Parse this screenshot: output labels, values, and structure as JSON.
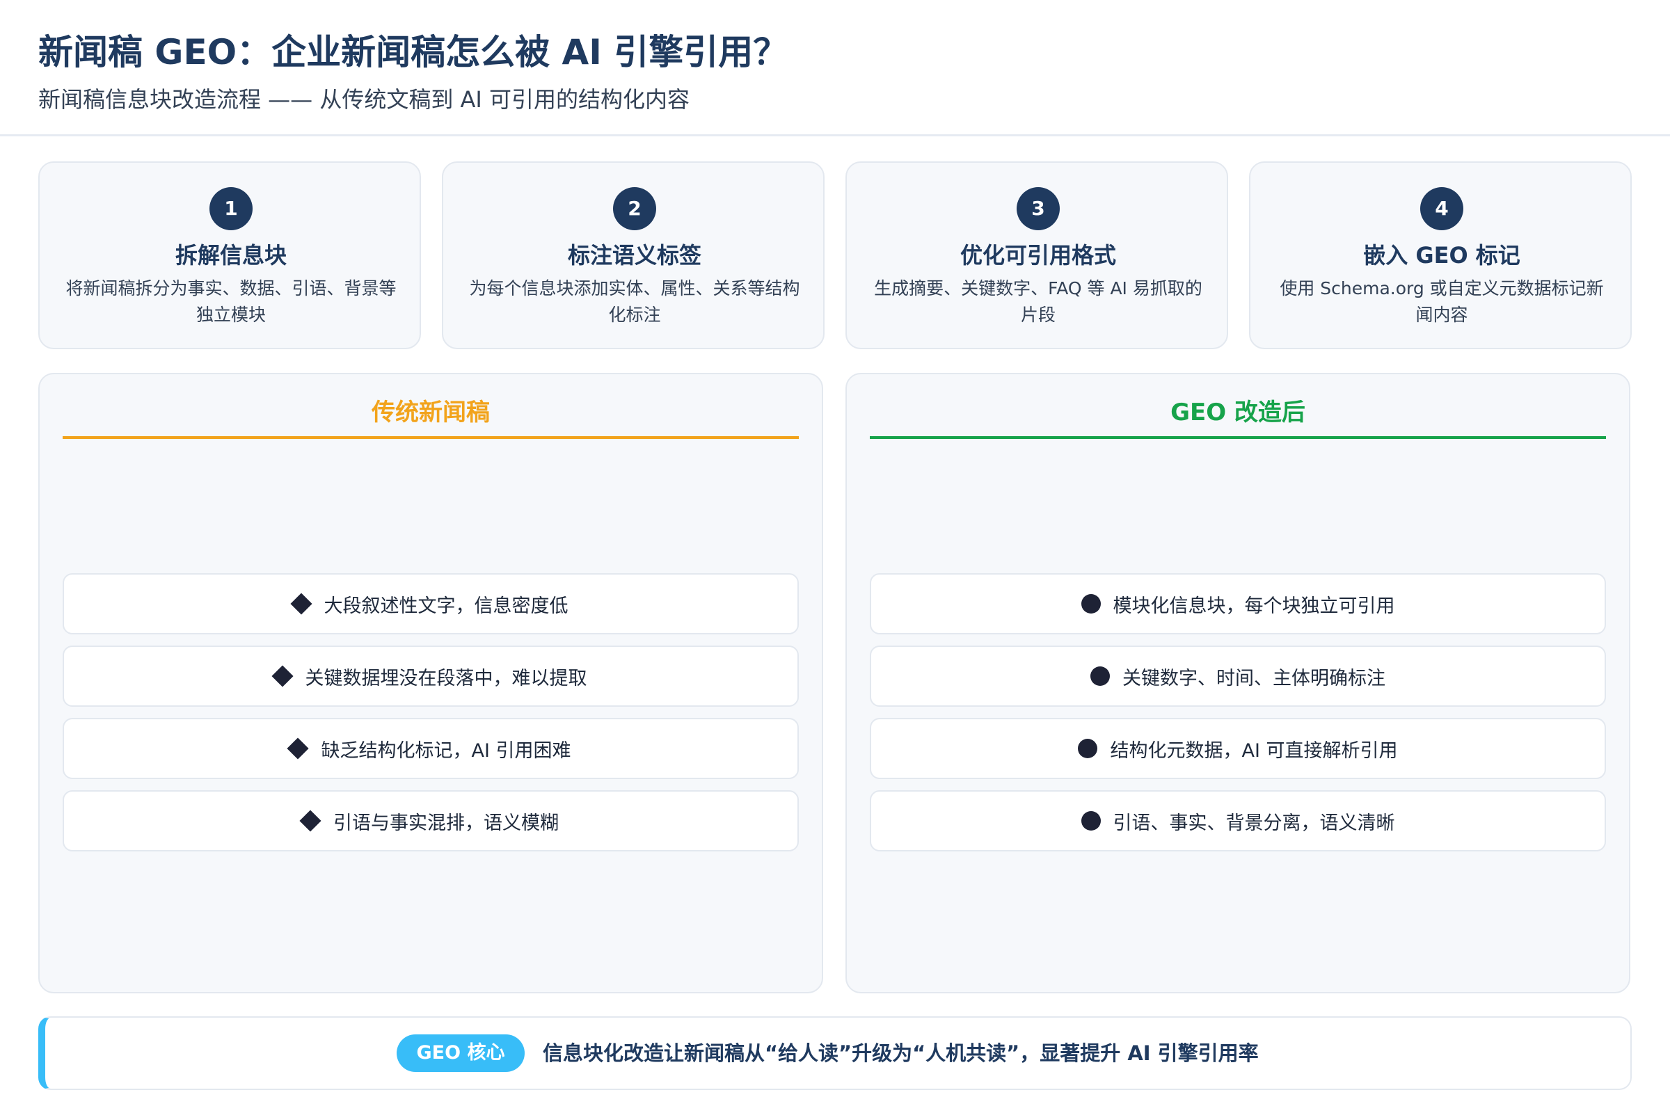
{
  "header": {
    "title": "新闻稿 GEO：企业新闻稿怎么被 AI 引擎引用？",
    "subtitle": "新闻稿信息块改造流程 —— 从传统文稿到 AI 可引用的结构化内容"
  },
  "steps": [
    {
      "number": "1",
      "title": "拆解信息块",
      "desc": "将新闻稿拆分为事实、数据、引语、背景等独立模块"
    },
    {
      "number": "2",
      "title": "标注语义标签",
      "desc": "为每个信息块添加实体、属性、关系等结构化标注"
    },
    {
      "number": "3",
      "title": "优化可引用格式",
      "desc": "生成摘要、关键数字、FAQ 等 AI 易抓取的片段"
    },
    {
      "number": "4",
      "title": "嵌入 GEO 标记",
      "desc": "使用 Schema.org 或自定义元数据标记新闻内容"
    }
  ],
  "traditional": {
    "title": "传统新闻稿",
    "accent": "#f2a31b",
    "items": [
      "大段叙述性文字，信息密度低",
      "关键数据埋没在段落中，难以提取",
      "缺乏结构化标记，AI 引用困难",
      "引语与事实混排，语义模糊"
    ]
  },
  "geo": {
    "title": "GEO 改造后",
    "accent": "#16a34a",
    "items": [
      "模块化信息块，每个块独立可引用",
      "关键数字、时间、主体明确标注",
      "结构化元数据，AI 可直接解析引用",
      "引语、事实、背景分离，语义清晰"
    ]
  },
  "callout": {
    "badge": "GEO 核心",
    "text": "信息块化改造让新闻稿从“给人读”升级为“人机共读”，显著提升 AI 引擎引用率",
    "accent": "#38bdf8"
  }
}
